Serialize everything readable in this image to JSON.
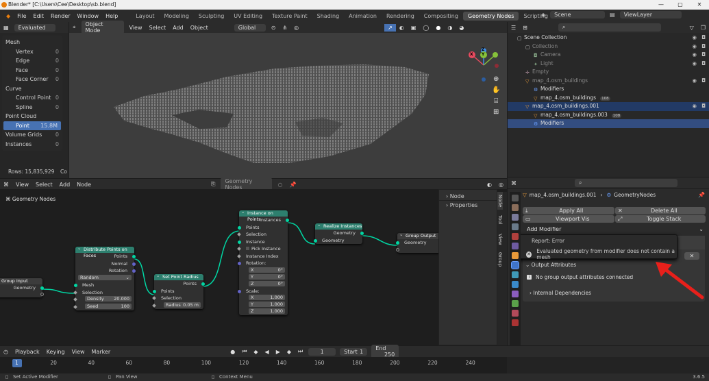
{
  "window": {
    "title": "Blender* [C:\\Users\\Cee\\Desktop\\sb.blend]",
    "min": "—",
    "max": "▢",
    "close": "✕"
  },
  "menu": [
    "File",
    "Edit",
    "Render",
    "Window",
    "Help"
  ],
  "workspaces": [
    "Layout",
    "Modeling",
    "Sculpting",
    "UV Editing",
    "Texture Paint",
    "Shading",
    "Animation",
    "Rendering",
    "Compositing",
    "Geometry Nodes",
    "Scripting",
    "+"
  ],
  "active_workspace": "Geometry Nodes",
  "scene": {
    "scene_label": "Scene",
    "viewlayer_label": "ViewLayer"
  },
  "spreadsheet": {
    "mode": "Evaluated",
    "tree": [
      {
        "label": "Mesh",
        "count": ""
      },
      {
        "label": "Vertex",
        "count": "0"
      },
      {
        "label": "Edge",
        "count": "0"
      },
      {
        "label": "Face",
        "count": "0"
      },
      {
        "label": "Face Corner",
        "count": "0"
      },
      {
        "label": "Curve",
        "count": ""
      },
      {
        "label": "Control Point",
        "count": "0"
      },
      {
        "label": "Spline",
        "count": "0"
      },
      {
        "label": "Point Cloud",
        "count": ""
      },
      {
        "label": "Point",
        "count": "15.8M"
      },
      {
        "label": "Volume Grids",
        "count": "0"
      },
      {
        "label": "Instances",
        "count": "0"
      }
    ],
    "rows": "Rows: 15,835,929",
    "col": "Co"
  },
  "viewport_header": {
    "mode": "Object Mode",
    "menus": [
      "View",
      "Select",
      "Add",
      "Object"
    ],
    "orientation": "Global"
  },
  "gizmo": {
    "x": "X",
    "y": "Y",
    "z": "Z"
  },
  "node_editor": {
    "menus": [
      "View",
      "Select",
      "Add",
      "Node"
    ],
    "tree_name": "Geometry Nodes",
    "breadcrumb": "Geometry Nodes",
    "side_tabs": [
      "Node",
      "Tool",
      "View",
      "Group"
    ],
    "side_panels": [
      "Node",
      "Properties"
    ],
    "nodes": {
      "group_input": {
        "title": "Group Input",
        "out": "Geometry"
      },
      "distribute": {
        "title": "Distribute Points on Faces",
        "outs": [
          "Points",
          "Normal",
          "Rotation"
        ],
        "mode": "Random",
        "ins": [
          "Mesh",
          "Selection"
        ],
        "density_label": "Density",
        "density": "20.000",
        "seed_label": "Seed",
        "seed": "100"
      },
      "set_radius": {
        "title": "Set Point Radius",
        "out": "Points",
        "ins": [
          "Points",
          "Selection"
        ],
        "radius_label": "Radius",
        "radius": "0.05 m"
      },
      "instance": {
        "title": "Instance on Points",
        "out": "Instances",
        "ins": [
          "Points",
          "Selection",
          "Instance",
          "Pick Instance",
          "Instance Index",
          "Rotation:"
        ],
        "rot": [
          [
            "X",
            "0°"
          ],
          [
            "Y",
            "0°"
          ],
          [
            "Z",
            "0°"
          ]
        ],
        "scale_label": "Scale:",
        "scale": [
          [
            "X",
            "1.000"
          ],
          [
            "Y",
            "1.000"
          ],
          [
            "Z",
            "1.000"
          ]
        ]
      },
      "realize": {
        "title": "Realize Instances",
        "out": "Geometry",
        "in": "Geometry"
      },
      "group_output": {
        "title": "Group Output",
        "in": "Geometry"
      }
    }
  },
  "outliner": {
    "rows": [
      {
        "label": "Scene Collection",
        "indent": 0,
        "icon": "collection",
        "dim": false
      },
      {
        "label": "Collection",
        "indent": 1,
        "icon": "collection",
        "dim": true
      },
      {
        "label": "Camera",
        "indent": 2,
        "icon": "camera",
        "dim": true
      },
      {
        "label": "Light",
        "indent": 2,
        "icon": "light",
        "dim": true
      },
      {
        "label": "Empty",
        "indent": 1,
        "icon": "empty",
        "dim": true
      },
      {
        "label": "map_4.osm_buildings",
        "indent": 1,
        "icon": "mesh",
        "dim": true
      },
      {
        "label": "Modifiers",
        "indent": 2,
        "icon": "wrench",
        "dim": false
      },
      {
        "label": "map_4.osm_buildings",
        "indent": 2,
        "icon": "mesh",
        "dim": false,
        "badge": "108"
      },
      {
        "label": "map_4.osm_buildings.001",
        "indent": 1,
        "icon": "mesh",
        "dim": false,
        "sel": "sel2"
      },
      {
        "label": "map_4.osm_buildings.003",
        "indent": 2,
        "icon": "mesh",
        "dim": false,
        "badge": "108"
      },
      {
        "label": "Modifiers",
        "indent": 2,
        "icon": "wrench",
        "dim": false,
        "sel": "sel"
      }
    ]
  },
  "properties": {
    "object": "map_4.osm_buildings.001",
    "modifier": "GeometryNodes",
    "apply_all": "Apply All",
    "delete_all": "Delete All",
    "viewport_vis": "Viewport Vis",
    "toggle_stack": "Toggle Stack",
    "add_modifier": "Add Modifier",
    "report_title": "Report: Error",
    "error": "Evaluated geometry from modifier does not contain a mesh",
    "output_attrs": "Output Attributes",
    "no_output": "No group output attributes connected",
    "internal_deps": "Internal Dependencies"
  },
  "timeline": {
    "menus": [
      "Playback",
      "Keying",
      "View",
      "Marker"
    ],
    "current_frame": "1",
    "start_label": "Start",
    "start": "1",
    "end_label": "End",
    "end": "250",
    "ticks": [
      "1",
      "20",
      "40",
      "60",
      "80",
      "100",
      "120",
      "140",
      "160",
      "180",
      "200",
      "220",
      "240"
    ]
  },
  "status": {
    "left": "Set Active Modifier",
    "mid": "Pan View",
    "right": "Context Menu",
    "version": "3.6.5"
  },
  "colors": {
    "accent": "#4772b3",
    "node_header": "#2d7f6e",
    "geometry_socket": "#00d6a3",
    "error_arrow": "#e8201b"
  }
}
